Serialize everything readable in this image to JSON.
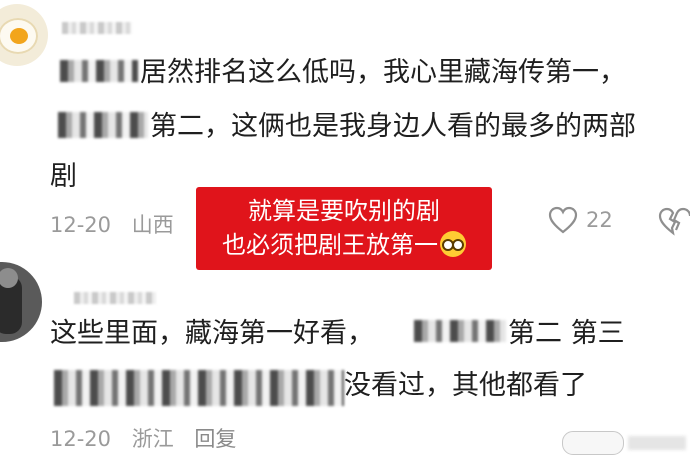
{
  "comments": [
    {
      "line1": "居然排名这么低吗，我心里藏海传第一，",
      "line2": "第二，这俩也是我身边人看的最多的两部",
      "line3": "剧",
      "date": "12-20",
      "location": "山西",
      "likes": "22"
    },
    {
      "line1": "这些里面，藏海第一好看，",
      "line1b": "第二 第三",
      "line2": "没看过，其他都看了",
      "date": "12-20",
      "location": "浙江",
      "reply": "回复"
    }
  ],
  "overlay": {
    "line1": "就算是要吹别的剧",
    "line2": "也必须把剧王放第一"
  },
  "icons": {
    "like": "heart-outline-icon",
    "dislike": "broken-heart-icon",
    "emoji": "nerd-face-emoji"
  },
  "colors": {
    "overlay_bg": "#e0141b",
    "meta_text": "#9a9a9a"
  }
}
